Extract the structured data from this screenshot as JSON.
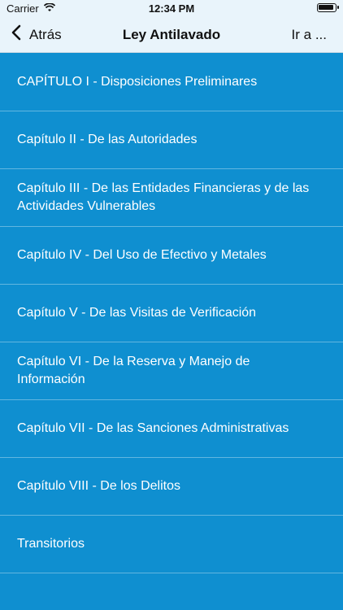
{
  "status_bar": {
    "carrier": "Carrier",
    "time": "12:34 PM"
  },
  "nav": {
    "back_label": "Atrás",
    "title": "Ley Antilavado",
    "goto_label": "Ir a ..."
  },
  "chapters": [
    {
      "label": "CAPÍTULO I - Disposiciones Preliminares"
    },
    {
      "label": "Capítulo II - De las Autoridades"
    },
    {
      "label": "Capítulo III - De las Entidades Financieras y de las Actividades Vulnerables"
    },
    {
      "label": "Capítulo IV - Del Uso de Efectivo y Metales"
    },
    {
      "label": "Capítulo V - De las Visitas de Verificación"
    },
    {
      "label": "Capítulo VI - De la Reserva y Manejo de Información"
    },
    {
      "label": "Capítulo VII - De las Sanciones Administrativas"
    },
    {
      "label": "Capítulo VIII - De los Delitos"
    },
    {
      "label": "Transitorios"
    }
  ]
}
